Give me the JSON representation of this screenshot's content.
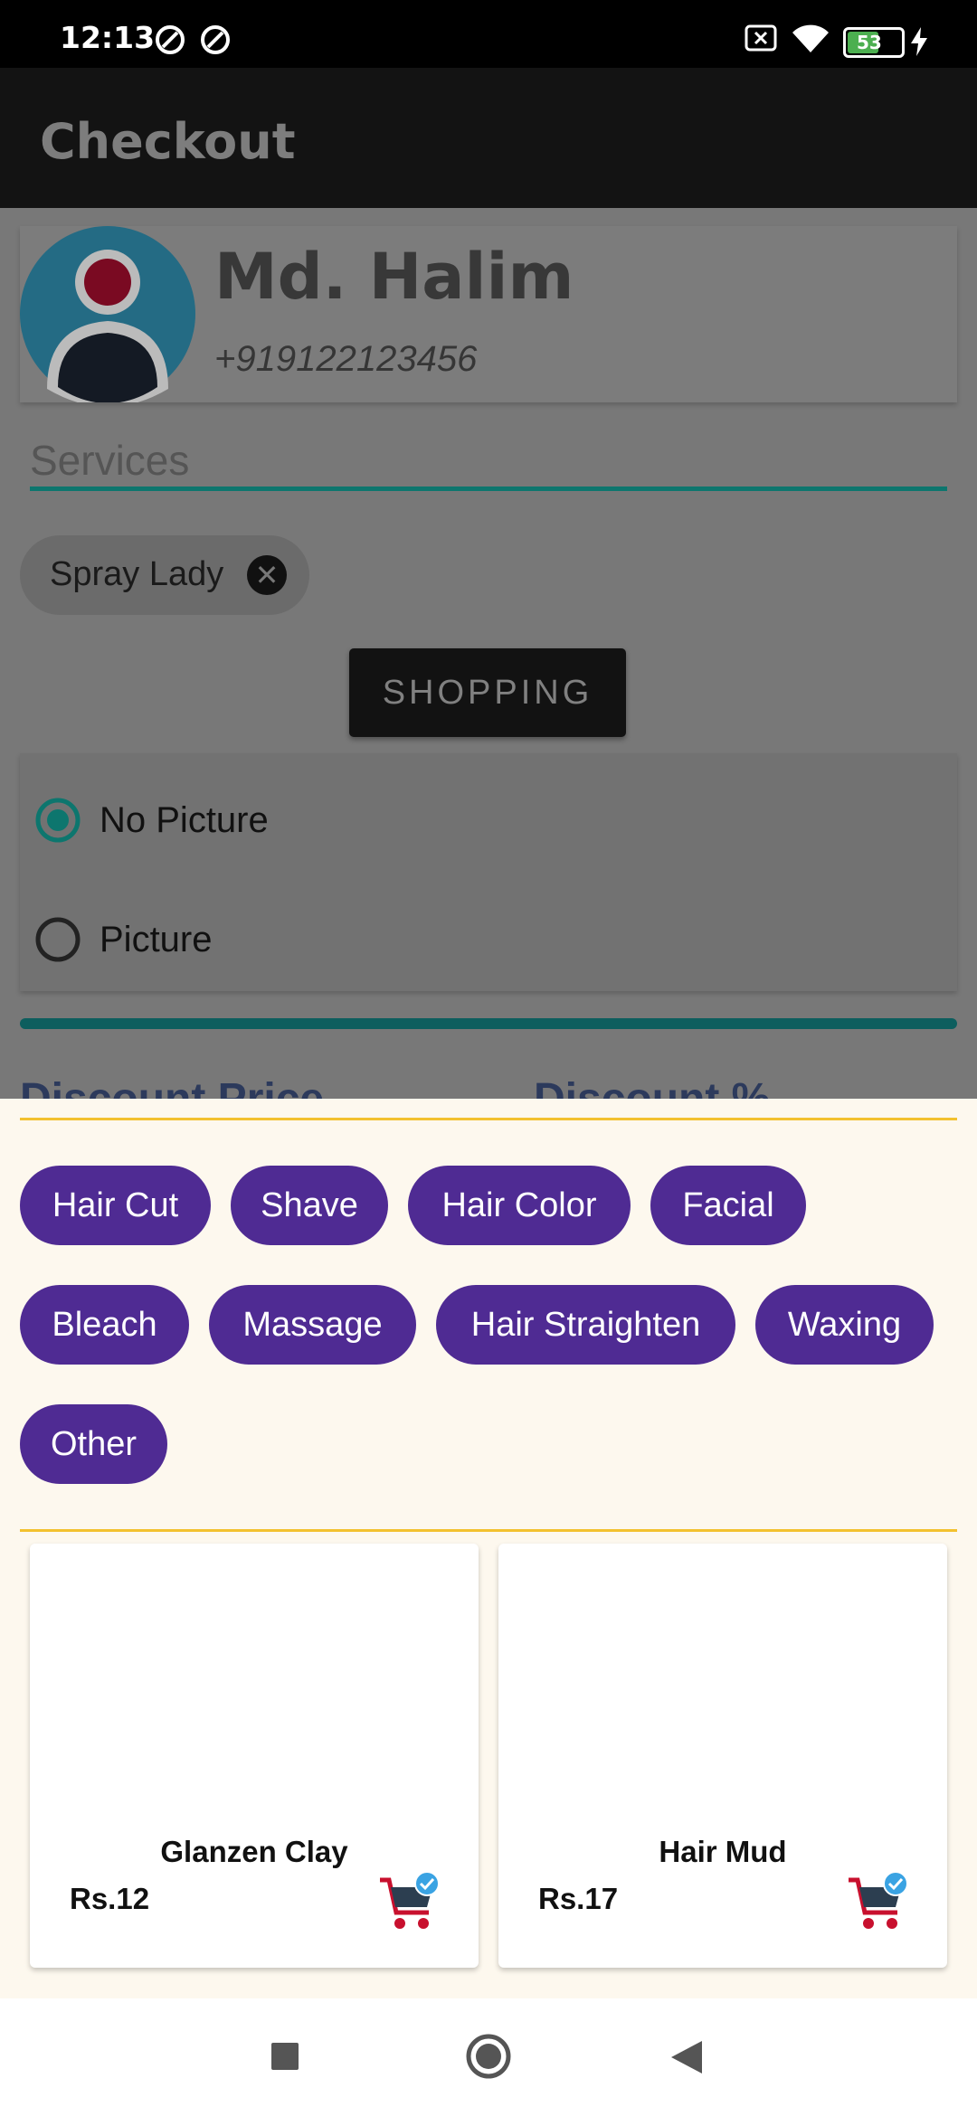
{
  "status_bar": {
    "time": "12:13",
    "battery": "53"
  },
  "app_bar": {
    "title": "Checkout"
  },
  "profile": {
    "name": "Md. Halim",
    "phone": "+919122123456"
  },
  "services": {
    "placeholder": "Services",
    "selected_chip": "Spray Lady"
  },
  "shopping_button": "SHOPPING",
  "picture_options": [
    {
      "label": "No Picture",
      "selected": true
    },
    {
      "label": "Picture",
      "selected": false
    }
  ],
  "hidden_labels": {
    "left": "Discount Price",
    "right": "Discount %"
  },
  "categories": [
    "Hair Cut",
    "Shave",
    "Hair Color",
    "Facial",
    "Bleach",
    "Massage",
    "Hair Straighten",
    "Waxing",
    "Other"
  ],
  "products": [
    {
      "name": "Glanzen Clay",
      "price": "Rs.12"
    },
    {
      "name": "Hair Mud",
      "price": "Rs.17"
    }
  ],
  "colors": {
    "accent_teal": "#0d766e",
    "category_purple": "#4f2b93",
    "divider_yellow": "#f3c12e",
    "cart_red": "#c8102e"
  }
}
